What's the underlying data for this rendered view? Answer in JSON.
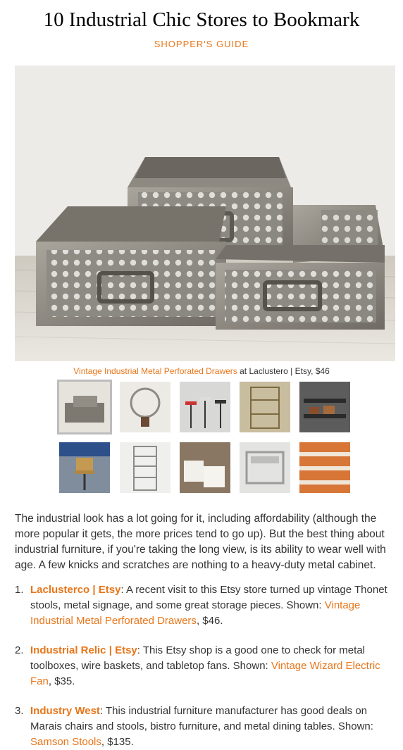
{
  "article": {
    "title": "10 Industrial Chic Stores to Bookmark",
    "kicker": "SHOPPER'S GUIDE"
  },
  "caption": {
    "link": "Vintage Industrial Metal Perforated Drawers",
    "rest": " at Laclustero | Etsy, $46"
  },
  "thumbnails": [
    {
      "subject": "metal perforated drawers",
      "selected": true
    },
    {
      "subject": "vintage electric fan",
      "selected": false
    },
    {
      "subject": "metal stools",
      "selected": false
    },
    {
      "subject": "wire shelving",
      "selected": false
    },
    {
      "subject": "industrial cart",
      "selected": false
    },
    {
      "subject": "desk chair with sign",
      "selected": false
    },
    {
      "subject": "metal shelving unit",
      "selected": false
    },
    {
      "subject": "canvas bags",
      "selected": false
    },
    {
      "subject": "metal kitchen cart",
      "selected": false
    },
    {
      "subject": "orange drawers",
      "selected": false
    }
  ],
  "intro": "The industrial look has a lot going for it, including affordability (although the more popular it gets, the more prices tend to go up). But the best thing about industrial furniture, if you're taking the long view, is its ability to wear well with age. A few knicks and scratches are nothing to a heavy-duty metal cabinet.",
  "stores": [
    {
      "num": "1.",
      "name": "Laclusterco",
      "sep": " | ",
      "platform": "Etsy",
      "desc": ": A recent visit to this Etsy store turned up vintage Thonet stools, metal signage, and some great storage pieces. Shown: ",
      "item": "Vintage Industrial Metal Perforated Drawers",
      "price": ", $46."
    },
    {
      "num": "2.",
      "name": "Industrial Relic",
      "sep": " | ",
      "platform": "Etsy",
      "desc": ": This Etsy shop is a good one to check for metal toolboxes, wire baskets, and tabletop fans. Shown: ",
      "item": "Vintage Wizard Electric Fan",
      "price": ", $35."
    },
    {
      "num": "3.",
      "name": "Industry West",
      "sep": "",
      "platform": "",
      "desc": ": This industrial furniture manufacturer has good deals on Marais chairs and stools, bistro furniture, and metal dining tables. Shown: ",
      "item": "Samson Stools",
      "price": ", $135."
    }
  ],
  "colors": {
    "accent": "#e8761a",
    "text": "#333333"
  }
}
